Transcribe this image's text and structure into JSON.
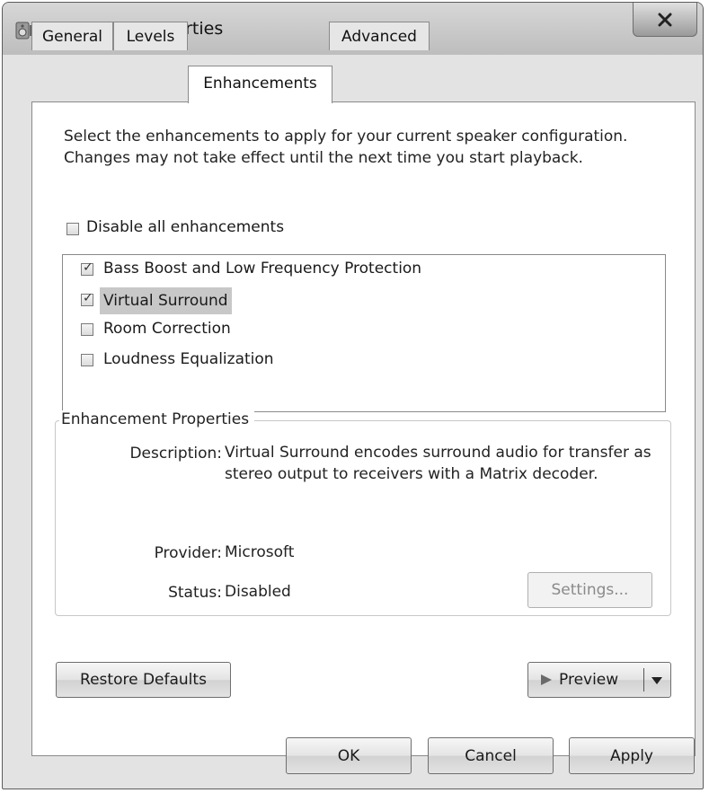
{
  "window": {
    "title": "Speakers Properties"
  },
  "tabs": [
    {
      "label": "General"
    },
    {
      "label": "Levels"
    },
    {
      "label": "Enhancements"
    },
    {
      "label": "Advanced"
    }
  ],
  "intro_text": "Select the enhancements to apply for your current speaker configuration. Changes may not take effect until the next time you start playback.",
  "disable_all": {
    "label": "Disable all enhancements",
    "checked": false
  },
  "enhancements": [
    {
      "label": "Bass Boost and Low Frequency Protection",
      "checked": true,
      "selected": false
    },
    {
      "label": "Virtual Surround",
      "checked": true,
      "selected": true
    },
    {
      "label": "Room Correction",
      "checked": false,
      "selected": false
    },
    {
      "label": "Loudness Equalization",
      "checked": false,
      "selected": false
    }
  ],
  "properties": {
    "group_title": "Enhancement Properties",
    "description_label": "Description:",
    "description_value": "Virtual Surround encodes surround audio for transfer as stereo output to receivers with a Matrix decoder.",
    "provider_label": "Provider:",
    "provider_value": "Microsoft",
    "status_label": "Status:",
    "status_value": "Disabled",
    "settings_button": "Settings..."
  },
  "buttons": {
    "restore_defaults": "Restore Defaults",
    "preview": "Preview",
    "ok": "OK",
    "cancel": "Cancel",
    "apply": "Apply"
  }
}
